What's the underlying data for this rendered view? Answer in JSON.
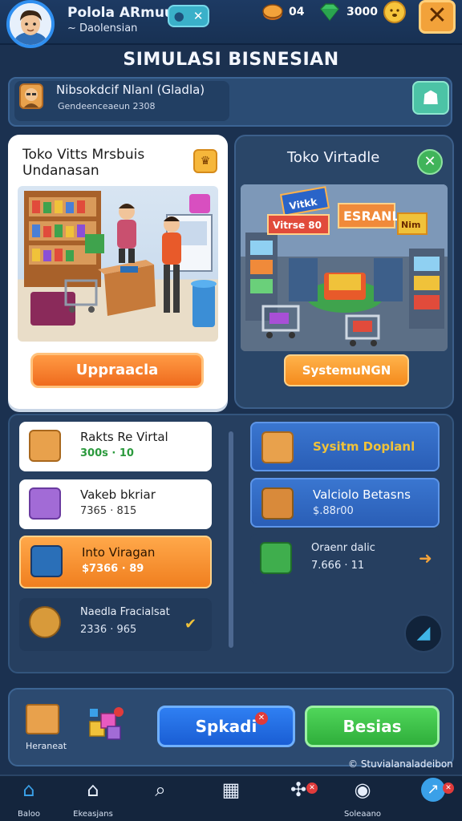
{
  "header": {
    "player_name": "Polola ARmuud",
    "player_sub": "~ Daolensian",
    "coins": "04",
    "gems": "3000"
  },
  "title": "SIMULASI BISNESIAN",
  "profile": {
    "name": "Nibsokdcif Nlanl (Gladla)",
    "sub": "Gendeenceaeun   2308"
  },
  "card_left": {
    "title": "Toko Vitts Mrsbuis Undanasan",
    "button": "Uppraacla"
  },
  "card_right": {
    "title": "Toko Virtadle",
    "button": "SystemuNGN",
    "signs": [
      "Vitkk",
      "Vitrse 80",
      "ESRANL",
      "Nim"
    ]
  },
  "left_list": [
    {
      "title": "Rakts Re Virtal",
      "value": "300s · 10",
      "style": "white"
    },
    {
      "title": "Vakeb bkriar",
      "value": "7365 · 815",
      "style": "white"
    },
    {
      "title": "Into Viragan",
      "value": "$7366 · 89",
      "style": "orange"
    },
    {
      "title": "Naedla Fracialsat",
      "value": "2336 · 965",
      "style": "dark"
    }
  ],
  "right_list": [
    {
      "title": "Sysitm Doplanl",
      "value": "",
      "style": "blue"
    },
    {
      "title": "Valciolo Betasns",
      "value": "$.88r00",
      "style": "blue"
    },
    {
      "title": "Oraenr dalic",
      "value": "7.666 · 11",
      "style": "dark"
    }
  ],
  "actions": {
    "box_label": "Heraneat",
    "spkadi": "Spkadi",
    "besias": "Besias",
    "credit": "© Stuvialanaladeibon"
  },
  "nav": [
    {
      "label": "Baloo",
      "icon": "home-icon"
    },
    {
      "label": "Ekeasjans",
      "icon": "house-outline-icon"
    },
    {
      "label": "",
      "icon": "search-icon"
    },
    {
      "label": "",
      "icon": "map-icon"
    },
    {
      "label": "",
      "icon": "tools-icon"
    },
    {
      "label": "Soleaano",
      "icon": "target-icon"
    },
    {
      "label": "",
      "icon": "trend-icon"
    }
  ],
  "colors": {
    "background": "#1b3150",
    "orange": "#ef6b1d",
    "blue": "#1a5ed4",
    "green": "#2fae3b"
  }
}
